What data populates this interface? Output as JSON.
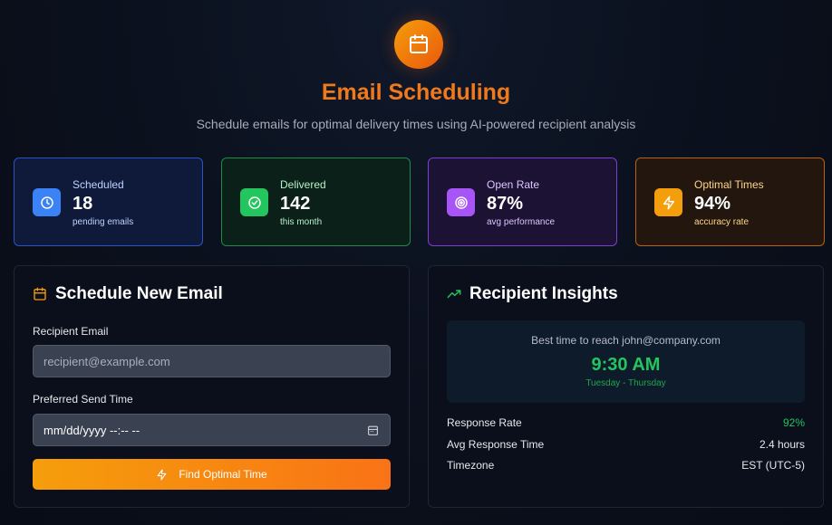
{
  "header": {
    "icon": "calendar-icon",
    "title": "Email Scheduling",
    "subtitle": "Schedule emails for optimal delivery times using AI-powered recipient analysis"
  },
  "stats": [
    {
      "icon": "clock-icon",
      "label": "Scheduled",
      "value": "18",
      "sub": "pending emails",
      "color": "#3b82f6"
    },
    {
      "icon": "check-circle-icon",
      "label": "Delivered",
      "value": "142",
      "sub": "this month",
      "color": "#22c55e"
    },
    {
      "icon": "target-icon",
      "label": "Open Rate",
      "value": "87%",
      "sub": "avg performance",
      "color": "#a855f7"
    },
    {
      "icon": "bolt-icon",
      "label": "Optimal Times",
      "value": "94%",
      "sub": "accuracy rate",
      "color": "#f59e0b"
    }
  ],
  "schedule": {
    "title": "Schedule New Email",
    "title_icon": "calendar-icon",
    "recipient_label": "Recipient Email",
    "recipient_placeholder": "recipient@example.com",
    "recipient_value": "",
    "time_label": "Preferred Send Time",
    "time_placeholder": "mm/dd/yyyy --:-- --",
    "button_label": "Find Optimal Time",
    "button_icon": "bolt-icon"
  },
  "insights": {
    "title": "Recipient Insights",
    "title_icon": "trending-up-icon",
    "best_label": "Best time to reach john@company.com",
    "best_time": "9:30 AM",
    "best_days": "Tuesday - Thursday",
    "rows": [
      {
        "label": "Response Rate",
        "value": "92%"
      },
      {
        "label": "Avg Response Time",
        "value": "2.4 hours"
      },
      {
        "label": "Timezone",
        "value": "EST (UTC-5)"
      }
    ]
  },
  "colors": {
    "accent": "#f0791c",
    "success": "#22c55e"
  }
}
